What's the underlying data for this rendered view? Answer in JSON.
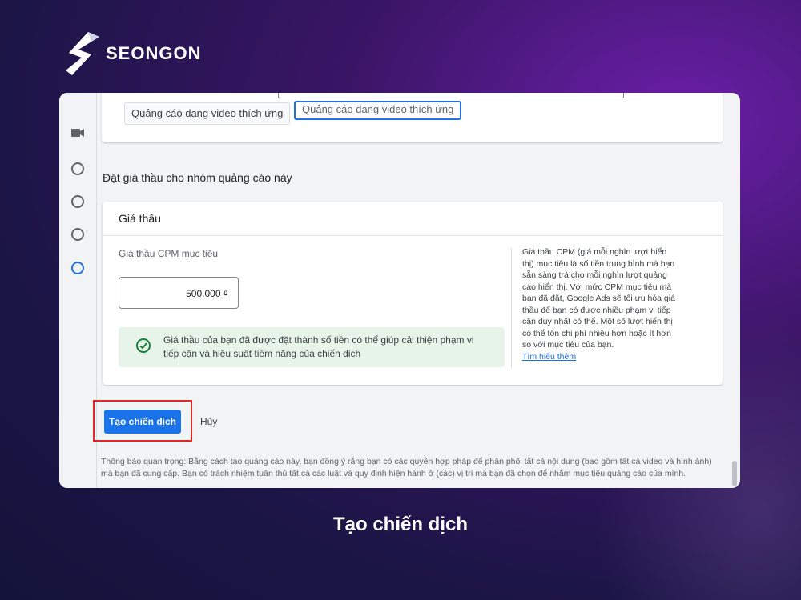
{
  "brand": {
    "name": "SEONGON"
  },
  "format_chips": {
    "inactive": "Quảng cáo dạng video thích ứng",
    "active": "Quảng cáo dạng video thích ứng"
  },
  "bidding": {
    "section_title": "Đặt giá thầu cho nhóm quảng cáo này",
    "card_title": "Giá thầu",
    "cpm_label": "Giá thầu CPM mục tiêu",
    "cpm_value": "500.000 ₫",
    "notice": "Giá thầu của bạn đã được đặt thành số tiền có thể giúp cải thiện phạm vi tiếp cận và hiệu suất tiềm năng của chiến dịch",
    "help_text": "Giá thầu CPM (giá mỗi nghìn lượt hiển thị) mục tiêu là số tiền trung bình mà bạn sẵn sàng trả cho mỗi nghìn lượt quảng cáo hiển thị. Với mức CPM mục tiêu mà bạn đã đặt, Google Ads sẽ tối ưu hóa giá thầu để bạn có được nhiều phạm vi tiếp cận duy nhất có thể. Một số lượt hiển thị có thể tốn chi phí nhiều hơn hoặc ít hơn so với mục tiêu của bạn.",
    "help_link": "Tìm hiểu thêm"
  },
  "actions": {
    "create_label": "Tạo chiến dịch",
    "cancel_label": "Hủy"
  },
  "legal_text": "Thông báo quan trọng: Bằng cách tạo quảng cáo này, bạn đồng ý rằng bạn có các quyền hợp pháp để phân phối tất cả nội dung (bao gồm tất cả video và hình ảnh) mà bạn đã cung cấp. Bạn có trách nhiệm tuân thủ tất cả các luật và quy định hiện hành ở (các) vị trí mà bạn đã chọn để nhắm mục tiêu quảng cáo của mình.",
  "caption": "Tạo chiến dịch",
  "colors": {
    "accent": "#1a73e8",
    "highlight": "#e52626",
    "success": "#188038"
  },
  "icons": [
    "video-camera-icon",
    "step-circle-icon",
    "check-circle-icon",
    "seongon-logo-icon"
  ]
}
